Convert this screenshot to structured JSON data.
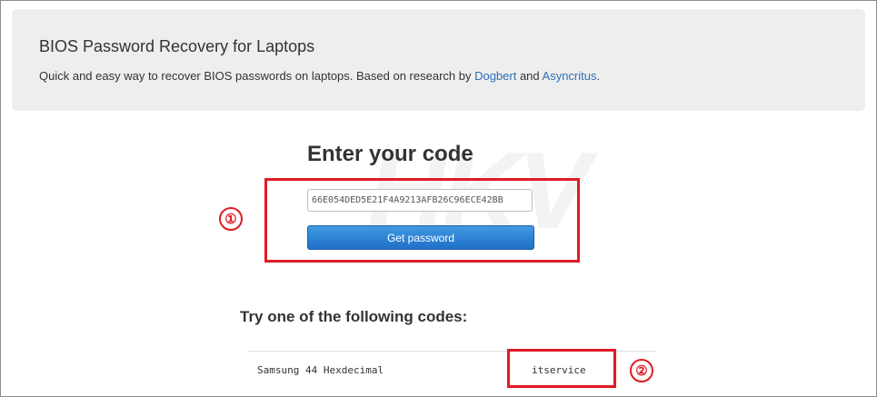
{
  "header": {
    "title": "BIOS Password Recovery for Laptops",
    "description_prefix": "Quick and easy way to recover BIOS passwords on laptops. Based on research by ",
    "link1": "Dogbert",
    "description_mid": " and ",
    "link2": "Asyncritus",
    "description_suffix": "."
  },
  "form": {
    "heading": "Enter your code",
    "code_value": "66E054DED5E21F4A9213AFB26C96ECE42BB",
    "button_label": "Get password"
  },
  "results": {
    "heading": "Try one of the following codes:",
    "rows": [
      {
        "vendor": "Samsung 44 Hexdecimal",
        "password": "itservice"
      }
    ]
  },
  "annotations": {
    "marker1": "①",
    "marker2": "②",
    "highlight_color": "#e01b24"
  },
  "watermark": {
    "text": "HKV"
  },
  "colors": {
    "link": "#2f6fb6",
    "button": "#2a7fd4",
    "jumbotron_bg": "#eeeeee"
  }
}
